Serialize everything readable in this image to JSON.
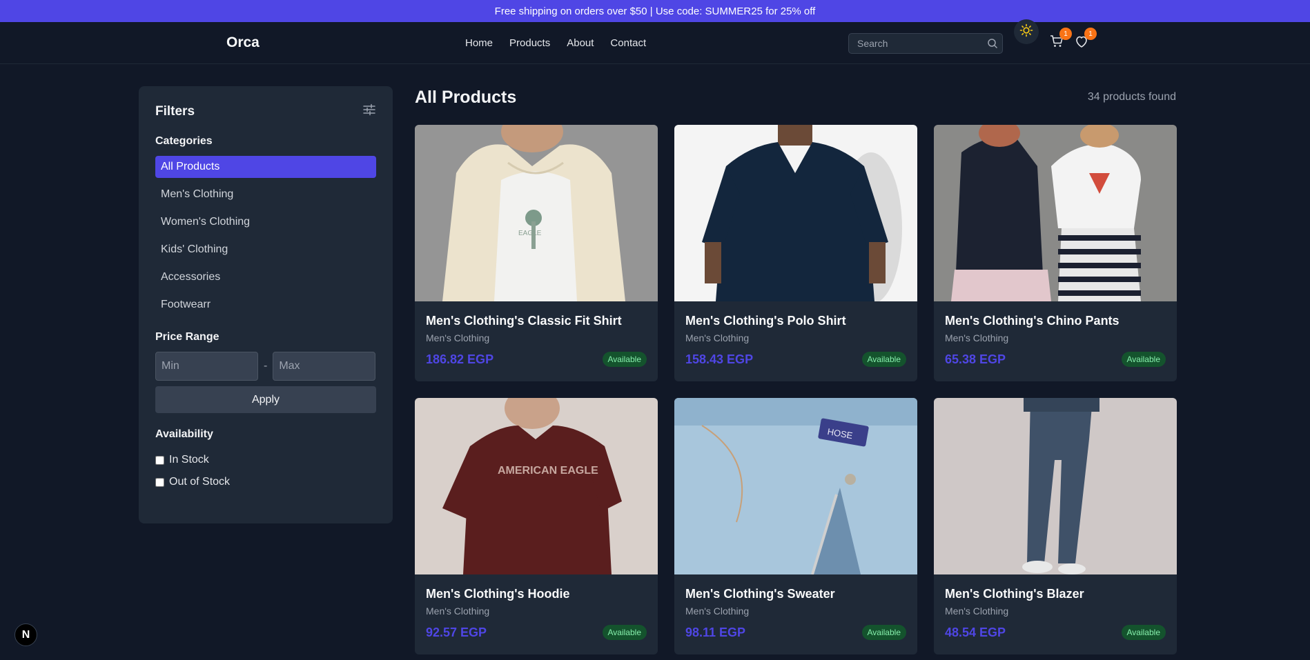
{
  "promo": {
    "text": "Free shipping on orders over $50 | Use code: SUMMER25 for 25% off"
  },
  "nav": {
    "brand": "Orca",
    "links": [
      "Home",
      "Products",
      "About",
      "Contact"
    ],
    "search_placeholder": "Search",
    "cart_count": "1",
    "wishlist_count": "1"
  },
  "filters": {
    "title": "Filters",
    "categories_title": "Categories",
    "categories": [
      "All Products",
      "Men's Clothing",
      "Women's Clothing",
      "Kids' Clothing",
      "Accessories",
      "Footwearr"
    ],
    "price_title": "Price Range",
    "min_placeholder": "Min",
    "max_placeholder": "Max",
    "dash": "-",
    "apply_label": "Apply",
    "availability_title": "Availability",
    "availability_options": [
      "In Stock",
      "Out of Stock"
    ]
  },
  "main": {
    "title": "All Products",
    "count": "34 products found"
  },
  "products": [
    {
      "name": "Men's Clothing's Classic Fit Shirt",
      "category": "Men's Clothing",
      "price": "186.82 EGP",
      "status": "Available"
    },
    {
      "name": "Men's Clothing's Polo Shirt",
      "category": "Men's Clothing",
      "price": "158.43 EGP",
      "status": "Available"
    },
    {
      "name": "Men's Clothing's Chino Pants",
      "category": "Men's Clothing",
      "price": "65.38 EGP",
      "status": "Available"
    },
    {
      "name": "Men's Clothing's Hoodie",
      "category": "Men's Clothing",
      "price": "92.57 EGP",
      "status": "Available"
    },
    {
      "name": "Men's Clothing's Sweater",
      "category": "Men's Clothing",
      "price": "98.11 EGP",
      "status": "Available"
    },
    {
      "name": "Men's Clothing's Blazer",
      "category": "Men's Clothing",
      "price": "48.54 EGP",
      "status": "Available"
    }
  ],
  "colors": {
    "accent": "#4f46e5",
    "background": "#111827",
    "panel": "#1f2937",
    "badge": "#f97316"
  },
  "next_logo": "N"
}
